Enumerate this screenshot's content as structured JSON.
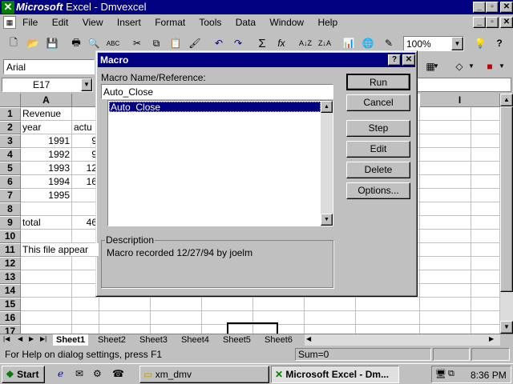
{
  "app": {
    "title_brand": "Microsoft",
    "title_rest": " Excel - Dmvexcel"
  },
  "menu": [
    "File",
    "Edit",
    "View",
    "Insert",
    "Format",
    "Tools",
    "Data",
    "Window",
    "Help"
  ],
  "toolbar": {
    "zoom": "100%"
  },
  "format_bar": {
    "font": "Arial"
  },
  "name_box": "E17",
  "columns": [
    "A",
    "I"
  ],
  "rows": [
    {
      "n": "1",
      "a": "Revenue",
      "b": ""
    },
    {
      "n": "2",
      "a": "year",
      "b": "actu"
    },
    {
      "n": "3",
      "a": "1991",
      "b": "9"
    },
    {
      "n": "4",
      "a": "1992",
      "b": "9"
    },
    {
      "n": "5",
      "a": "1993",
      "b": "12"
    },
    {
      "n": "6",
      "a": "1994",
      "b": "16"
    },
    {
      "n": "7",
      "a": "1995",
      "b": ""
    },
    {
      "n": "8",
      "a": "",
      "b": ""
    },
    {
      "n": "9",
      "a": "total",
      "b": "46"
    },
    {
      "n": "10",
      "a": "",
      "b": ""
    },
    {
      "n": "11",
      "a": "This file appear",
      "b": ""
    },
    {
      "n": "12",
      "a": "",
      "b": ""
    },
    {
      "n": "13",
      "a": "",
      "b": ""
    },
    {
      "n": "14",
      "a": "",
      "b": ""
    },
    {
      "n": "15",
      "a": "",
      "b": ""
    },
    {
      "n": "16",
      "a": "",
      "b": ""
    },
    {
      "n": "17",
      "a": "",
      "b": ""
    }
  ],
  "sheets": [
    "Sheet1",
    "Sheet2",
    "Sheet3",
    "Sheet4",
    "Sheet5",
    "Sheet6"
  ],
  "status": {
    "help": "For Help on dialog settings, press F1",
    "sum": "Sum=0"
  },
  "dialog": {
    "title": "Macro",
    "name_label": "Macro Name/Reference:",
    "name_value": "Auto_Close",
    "list_items": [
      "Auto_Close"
    ],
    "buttons": {
      "run": "Run",
      "cancel": "Cancel",
      "step": "Step",
      "edit": "Edit",
      "delete": "Delete",
      "options": "Options..."
    },
    "description_label": "Description",
    "description_text": "Macro recorded 12/27/94 by joelm"
  },
  "taskbar": {
    "start": "Start",
    "tasks": [
      "xm_dmv",
      "Microsoft Excel - Dm..."
    ],
    "clock": "8:36 PM"
  }
}
